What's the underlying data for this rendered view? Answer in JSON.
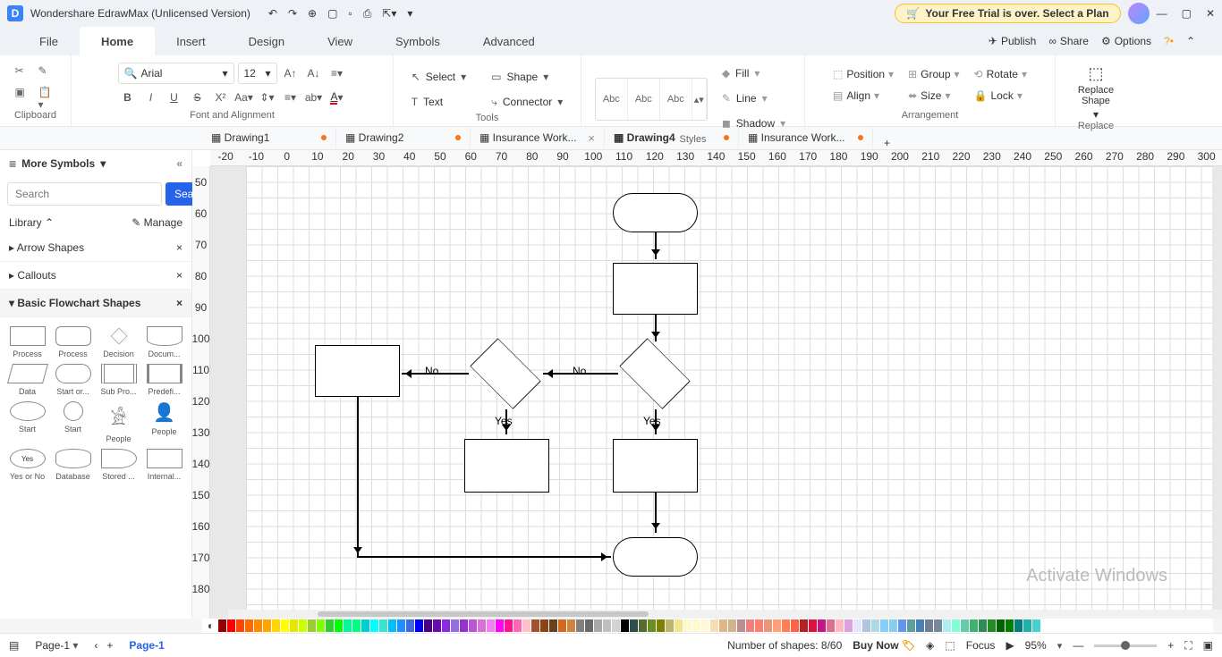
{
  "app": {
    "title": "Wondershare EdrawMax (Unlicensed Version)"
  },
  "trial": {
    "text": "Your Free Trial is over. Select a Plan",
    "icon": "🛒"
  },
  "menu": {
    "items": [
      "File",
      "Home",
      "Insert",
      "Design",
      "View",
      "Symbols",
      "Advanced"
    ],
    "active": "Home",
    "right": [
      "Publish",
      "Share",
      "Options"
    ]
  },
  "ribbon": {
    "clipboard": "Clipboard",
    "font": "Font and Alignment",
    "font_name": "Arial",
    "font_size": "12",
    "tools": "Tools",
    "select": "Select",
    "shape": "Shape",
    "text": "Text",
    "connector": "Connector",
    "styles": "Styles",
    "style_labels": [
      "Abc",
      "Abc",
      "Abc"
    ],
    "fill": "Fill",
    "line": "Line",
    "shadow": "Shadow",
    "arrangement": "Arrangement",
    "position": "Position",
    "align": "Align",
    "group": "Group",
    "size": "Size",
    "rotate": "Rotate",
    "lock": "Lock",
    "replace": "Replace",
    "replace_shape": "Replace\nShape"
  },
  "tabs": [
    {
      "name": "Drawing1",
      "dot": true
    },
    {
      "name": "Drawing2",
      "dot": true
    },
    {
      "name": "Insurance Work...",
      "close": true
    },
    {
      "name": "Drawing4",
      "active": true,
      "dot": true
    },
    {
      "name": "Insurance Work...",
      "dot": true
    }
  ],
  "sidebar": {
    "title": "More Symbols",
    "search_placeholder": "Search",
    "search_btn": "Search",
    "library": "Library",
    "manage": "Manage",
    "cats": [
      "Arrow Shapes",
      "Callouts",
      "Basic Flowchart Shapes"
    ],
    "shapes": [
      "Process",
      "Process",
      "Decision",
      "Docum...",
      "Data",
      "Start or...",
      "Sub Pro...",
      "Predefi...",
      "Start",
      "Start",
      "People",
      "People",
      "Yes or No",
      "Database",
      "Stored ...",
      "Internal..."
    ]
  },
  "ruler_h": [
    "-20",
    "-10",
    "0",
    "10",
    "20",
    "30",
    "40",
    "50",
    "60",
    "70",
    "80",
    "90",
    "100",
    "110",
    "120",
    "130",
    "140",
    "150",
    "160",
    "170",
    "180",
    "190",
    "200",
    "210",
    "220",
    "230",
    "240",
    "250",
    "260",
    "270",
    "280",
    "290",
    "300"
  ],
  "ruler_v": [
    "50",
    "60",
    "70",
    "80",
    "90",
    "100",
    "110",
    "120",
    "130",
    "140",
    "150",
    "160",
    "170",
    "180"
  ],
  "flow": {
    "no1": "No",
    "no2": "No",
    "yes1": "Yes",
    "yes2": "Yes"
  },
  "status": {
    "page": "Page-1",
    "page_main": "Page-1",
    "shapes": "Number of shapes: 8/60",
    "buy": "Buy Now",
    "focus": "Focus",
    "zoom": "95%"
  },
  "watermark": "Activate Windows",
  "colors": [
    "#960000",
    "#ff0000",
    "#ff4500",
    "#ff6a00",
    "#ff8c00",
    "#ffa500",
    "#ffd700",
    "#ffff00",
    "#e6e600",
    "#ccff00",
    "#9acd32",
    "#7fff00",
    "#32cd32",
    "#00ff00",
    "#00fa9a",
    "#00ff7f",
    "#00ced1",
    "#00ffff",
    "#40e0d0",
    "#00bfff",
    "#1e90ff",
    "#4169e1",
    "#0000ff",
    "#4b0082",
    "#6a0dad",
    "#8a2be2",
    "#9370db",
    "#9932cc",
    "#ba55d3",
    "#da70d6",
    "#ee82ee",
    "#ff00ff",
    "#ff1493",
    "#ff69b4",
    "#ffc0cb",
    "#a0522d",
    "#8b4513",
    "#654321",
    "#d2691e",
    "#cd853f",
    "#808080",
    "#696969",
    "#a9a9a9",
    "#c0c0c0",
    "#d3d3d3",
    "#000000",
    "#2f4f4f",
    "#556b2f",
    "#6b8e23",
    "#808000",
    "#bdb76b",
    "#f0e68c",
    "#fafad2",
    "#fffacd",
    "#fff8dc",
    "#f5deb3",
    "#deb887",
    "#d2b48c",
    "#bc8f8f",
    "#f08080",
    "#fa8072",
    "#e9967a",
    "#ffa07a",
    "#ff7f50",
    "#ff6347",
    "#b22222",
    "#dc143c",
    "#c71585",
    "#db7093",
    "#ffb6c1",
    "#dda0dd",
    "#e6e6fa",
    "#b0c4de",
    "#add8e6",
    "#87cefa",
    "#87ceeb",
    "#6495ed",
    "#5f9ea0",
    "#4682b4",
    "#708090",
    "#778899",
    "#afeeee",
    "#7fffd4",
    "#66cdaa",
    "#3cb371",
    "#2e8b57",
    "#228b22",
    "#006400",
    "#008000",
    "#008080",
    "#20b2aa",
    "#48d1cc"
  ]
}
